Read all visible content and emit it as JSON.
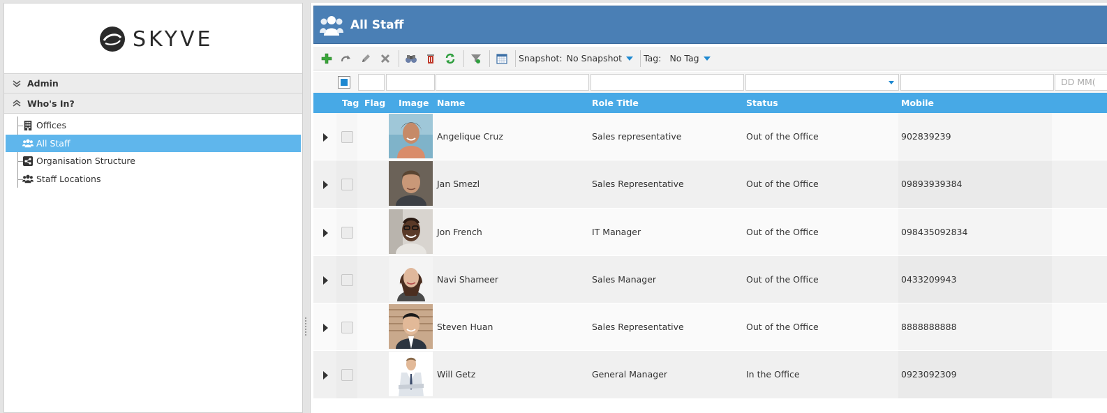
{
  "app": {
    "logo_text": "SKYVE"
  },
  "sidebar": {
    "sections": [
      {
        "label": "Admin",
        "state": "collapsed"
      },
      {
        "label": "Who's In?",
        "state": "expanded"
      }
    ],
    "items": [
      {
        "label": "Offices",
        "icon": "building-icon",
        "selected": false
      },
      {
        "label": "All Staff",
        "icon": "users-icon",
        "selected": true
      },
      {
        "label": "Organisation Structure",
        "icon": "share-icon",
        "selected": false
      },
      {
        "label": "Staff Locations",
        "icon": "users-icon",
        "selected": false
      }
    ]
  },
  "main": {
    "title": "All Staff",
    "toolbar": {
      "buttons": [
        "add-icon",
        "redo-icon",
        "edit-icon",
        "delete-icon",
        "binoculars-icon",
        "trash-icon",
        "refresh-icon",
        "filter-icon",
        "calendar-icon"
      ],
      "snapshot_label": "Snapshot:",
      "snapshot_value": "No Snapshot",
      "tag_label": "Tag:",
      "tag_value": "No Tag"
    },
    "filter": {
      "date_placeholder": "DD MM("
    },
    "columns": [
      "Tag",
      "Flag",
      "Image",
      "Name",
      "Role Title",
      "Status",
      "Mobile"
    ],
    "rows": [
      {
        "name": "Angelique Cruz",
        "role": "Sales representative",
        "status": "Out of the Office",
        "mobile": "902839239"
      },
      {
        "name": "Jan Smezl",
        "role": "Sales Representative",
        "status": "Out of the Office",
        "mobile": "09893939384"
      },
      {
        "name": "Jon French",
        "role": "IT Manager",
        "status": "Out of the Office",
        "mobile": "098435092834"
      },
      {
        "name": "Navi Shameer",
        "role": "Sales Manager",
        "status": "Out of the Office",
        "mobile": "0433209943"
      },
      {
        "name": "Steven Huan",
        "role": "Sales Representative",
        "status": "Out of the Office",
        "mobile": "8888888888"
      },
      {
        "name": "Will Getz",
        "role": "General Manager",
        "status": "In the Office",
        "mobile": "0923092309"
      }
    ]
  },
  "colors": {
    "title_bar": "#4a7fb5",
    "grid_header": "#47a9e6",
    "selected_item": "#5fb6ec",
    "accent": "#1e88d0"
  }
}
